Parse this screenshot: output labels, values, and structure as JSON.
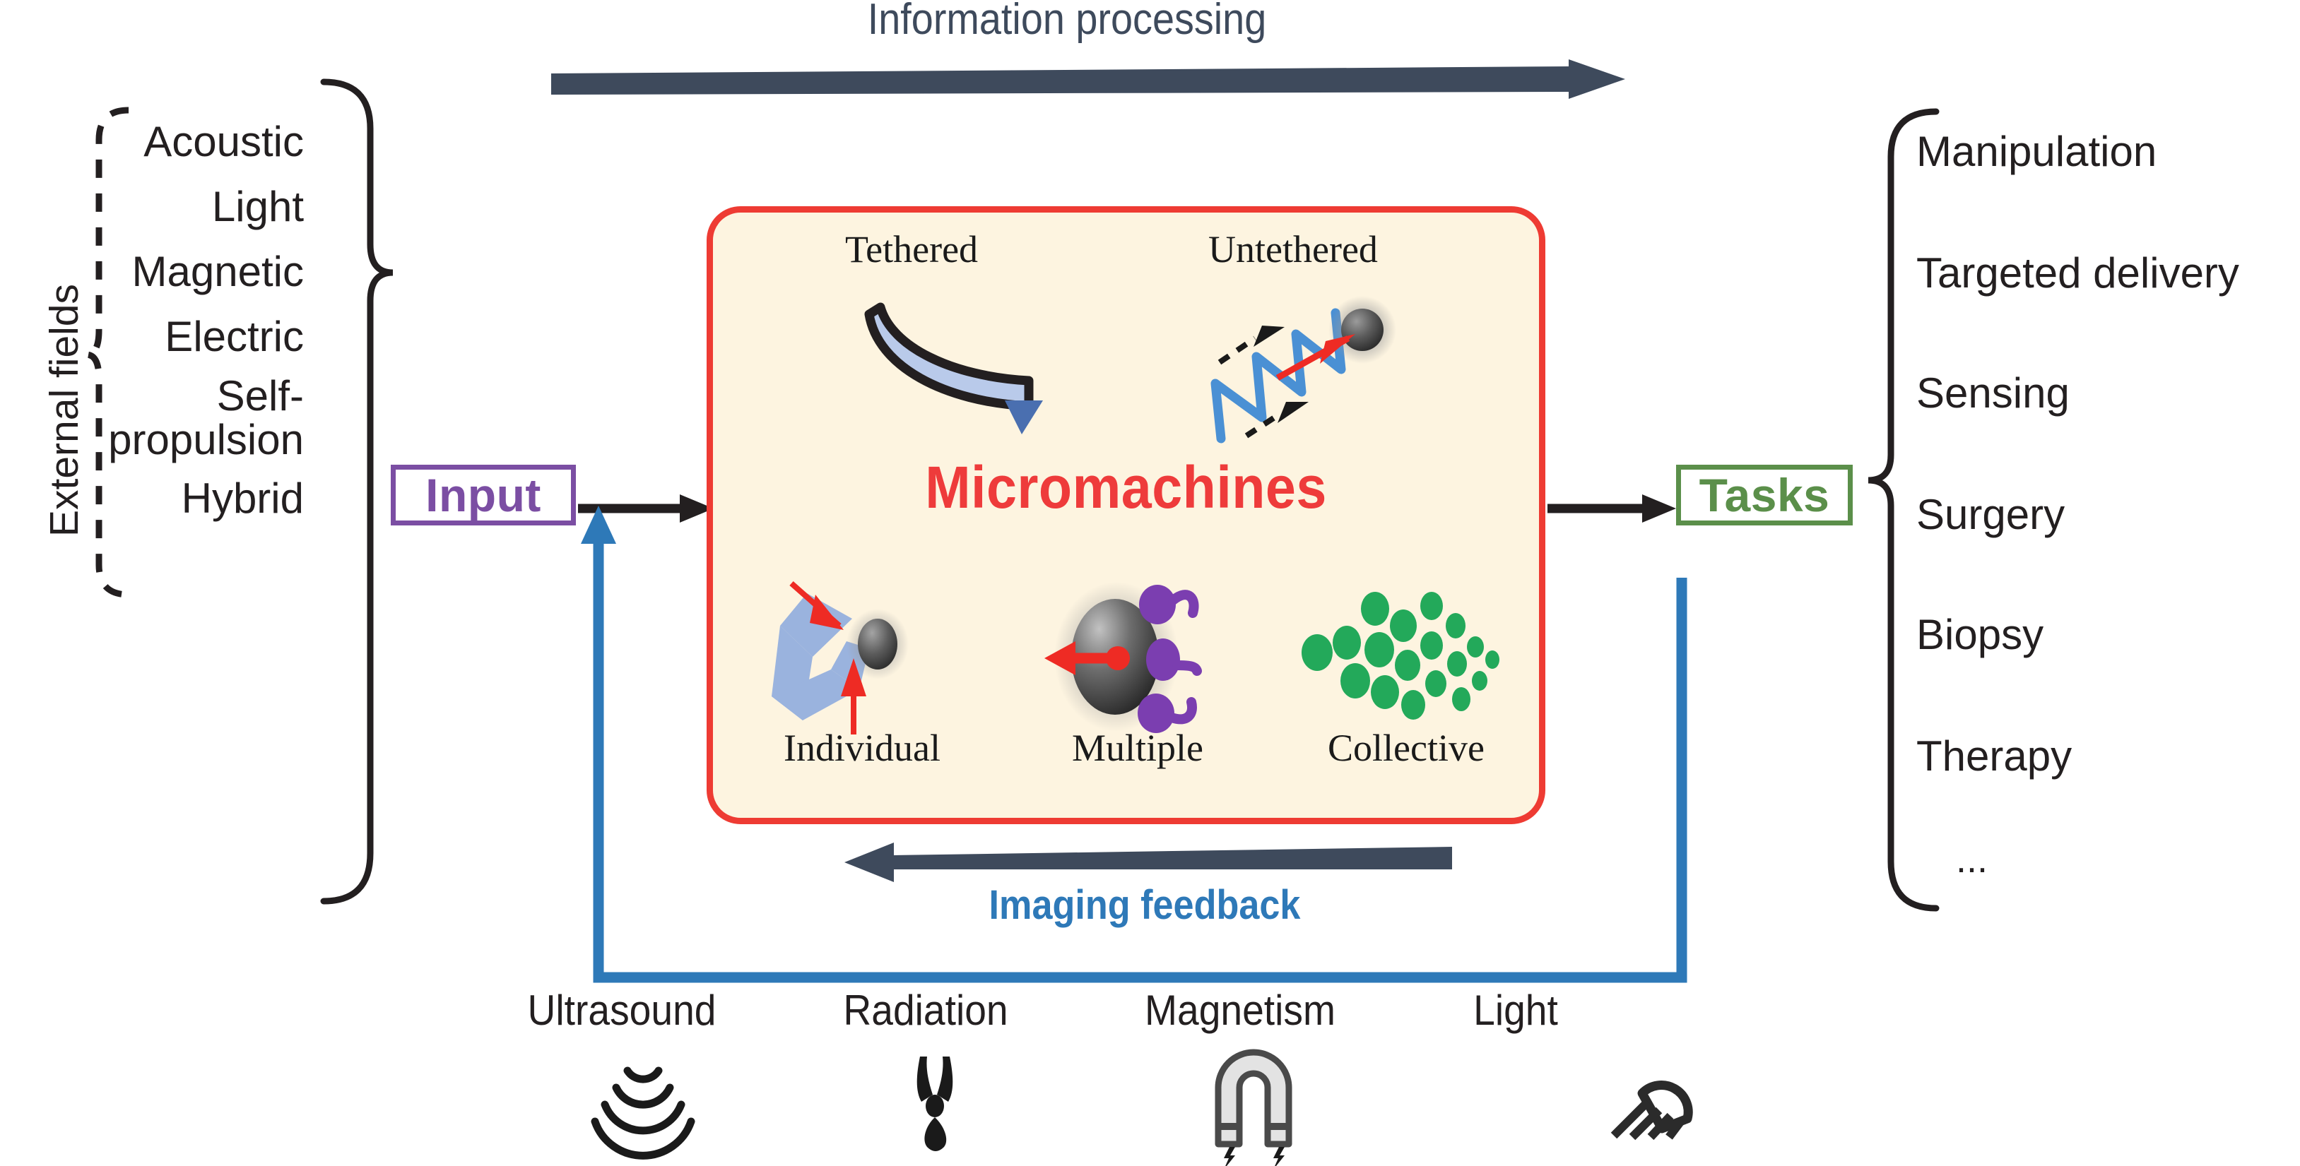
{
  "figure": {
    "title": "Micromachines information-processing and imaging-feedback loop diagram",
    "background_color": "#ffffff"
  },
  "top_flow": {
    "label": "Information processing",
    "arrow_color": "#3e4a5c",
    "direction": "left-to-right"
  },
  "bottom_flow": {
    "label": "Imaging feedback",
    "arrow_color": "#3e4a5c",
    "label_color": "#2e79b8",
    "feedback_line_color": "#2e79b8",
    "direction": "right-to-left"
  },
  "left_panel": {
    "caption": "External fields",
    "bracket_color": "#231f20",
    "dashed_bracket_color": "#231f20",
    "items": [
      {
        "label": "Acoustic",
        "grouped": true
      },
      {
        "label": "Light",
        "grouped": true
      },
      {
        "label": "Magnetic",
        "grouped": true
      },
      {
        "label": "Electric",
        "grouped": true
      },
      {
        "label": "Self-\npropulsion",
        "grouped": false
      },
      {
        "label": "Hybrid",
        "grouped": false
      }
    ]
  },
  "input_node": {
    "label": "Input",
    "border_color": "#7b4ea3",
    "text_color": "#7b4ea3"
  },
  "tasks_node": {
    "label": "Tasks",
    "border_color": "#5b8f4a",
    "text_color": "#5b8f4a"
  },
  "center_panel": {
    "title": "Micromachines",
    "title_color": "#ee3b3b",
    "border_color": "#ee3b33",
    "fill_color": "#fdf4e0",
    "top_row": [
      {
        "caption": "Tethered",
        "icon": "tethered-filament-icon"
      },
      {
        "caption": "Untethered",
        "icon": "helical-swimmer-icon"
      }
    ],
    "bottom_row": [
      {
        "caption": "Individual",
        "icon": "microgripper-icon"
      },
      {
        "caption": "Multiple",
        "icon": "flagellated-particle-icon"
      },
      {
        "caption": "Collective",
        "icon": "swarm-icon"
      }
    ]
  },
  "right_panel": {
    "bracket_color": "#231f20",
    "items": [
      "Manipulation",
      "Targeted delivery",
      "Sensing",
      "Surgery",
      "Biopsy",
      "Therapy",
      "..."
    ]
  },
  "imaging_modalities": [
    {
      "label": "Ultrasound",
      "icon": "ultrasound-waves-icon"
    },
    {
      "label": "Radiation",
      "icon": "radiation-trefoil-icon"
    },
    {
      "label": "Magnetism",
      "icon": "horseshoe-magnet-icon"
    },
    {
      "label": "Light",
      "icon": "lamp-rays-icon"
    }
  ]
}
